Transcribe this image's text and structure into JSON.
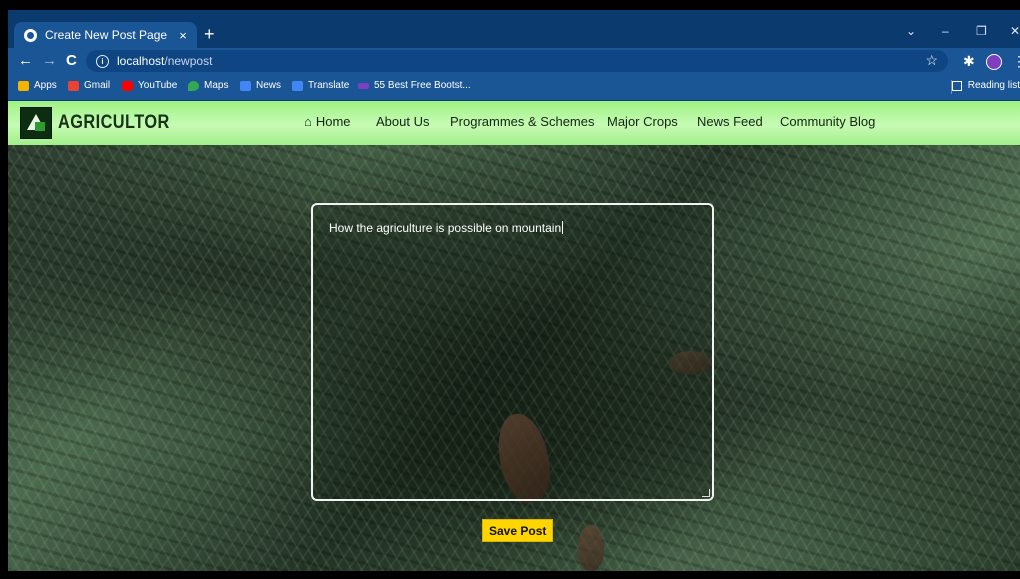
{
  "browser": {
    "tab_title": "Create New Post Page",
    "tab_close": "×",
    "new_tab": "+",
    "window_controls": {
      "dropdown": "⌄",
      "minimize": "–",
      "restore": "❐",
      "close": "✕"
    },
    "nav": {
      "back": "←",
      "forward": "→",
      "reload": "C"
    },
    "url_host": "localhost",
    "url_path": "/newpost",
    "bookmark_star": "☆",
    "bookmarks": [
      {
        "label": "Apps",
        "color": "#f4b400"
      },
      {
        "label": "Gmail",
        "color": "#ea4335"
      },
      {
        "label": "YouTube",
        "color": "#ff0000"
      },
      {
        "label": "Maps",
        "color": "#34a853"
      },
      {
        "label": "News",
        "color": "#4285f4"
      },
      {
        "label": "Translate",
        "color": "#4285f4"
      },
      {
        "label": "55 Best Free Bootst...",
        "color": "#7b3fbf"
      }
    ],
    "reading_list": "Reading list"
  },
  "site": {
    "logo_text": "AGRICULTOR",
    "nav_home_icon": "⌂",
    "nav": [
      "Home",
      "About Us",
      "Programmes & Schemes",
      "Major Crops",
      "News Feed",
      "Community Blog"
    ]
  },
  "editor": {
    "content": "How the agriculture is possible on mountain"
  },
  "save_button": "Save Post"
}
